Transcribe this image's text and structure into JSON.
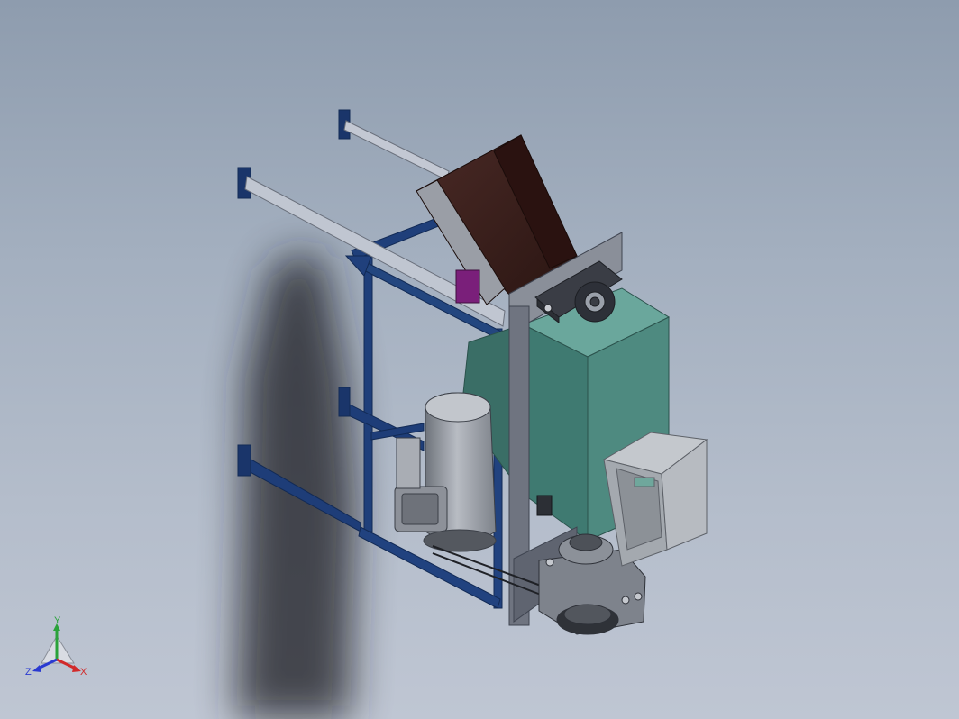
{
  "viewport": {
    "background_top": "#8e9cae",
    "background_bottom": "#bfc6d3"
  },
  "model": {
    "parts": [
      "wall-frame",
      "rear-rails",
      "hopper",
      "pillow-block-bearing",
      "housing",
      "electric-motor",
      "belt-drive",
      "chute",
      "gear-reducer",
      "mount-plate"
    ],
    "colors": {
      "frame": "#1f3f7a",
      "rails": "#b9bfcc",
      "hopper": "#3a1f1c",
      "housing": "#4e8a80",
      "motor": "#8e939c",
      "chute": "#a9aeb4",
      "plate": "#6f7480",
      "bracket": "#7a1f7a"
    }
  },
  "triad": {
    "x_label": "X",
    "y_label": "Y",
    "z_label": "Z",
    "x_color": "#d12a2a",
    "y_color": "#2aa23a",
    "z_color": "#2a3ad1"
  }
}
